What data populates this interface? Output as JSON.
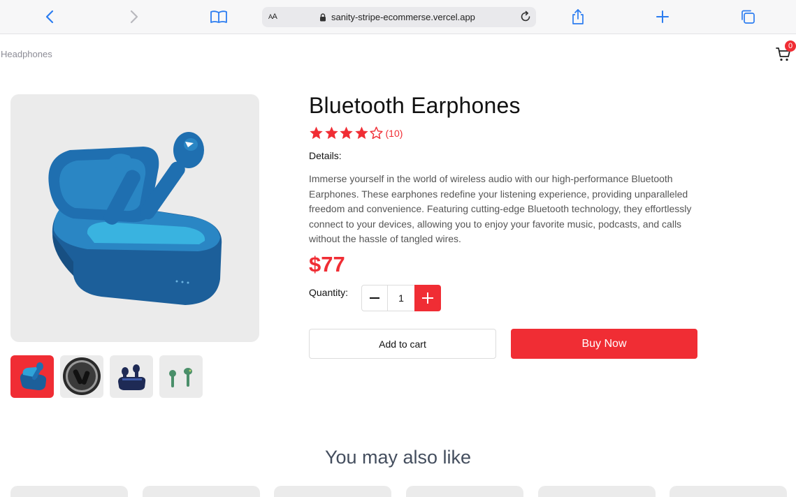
{
  "browser": {
    "aa_label": "AA",
    "url": "sanity-stripe-ecommerse.vercel.app"
  },
  "nav": {
    "breadcrumb": "Headphones",
    "cart_count": "0"
  },
  "product": {
    "title": "Bluetooth Earphones",
    "rating_stars": 4,
    "rating_max": 5,
    "review_count": "(10)",
    "details_label": "Details:",
    "description": "Immerse yourself in the world of wireless audio with our high-performance Bluetooth Earphones. These earphones redefine your listening experience, providing unparalleled freedom and convenience. Featuring cutting-edge Bluetooth technology, they effortlessly connect to your devices, allowing you to enjoy your favorite music, podcasts, and calls without the hassle of tangled wires.",
    "price": "$77",
    "quantity_label": "Quantity:",
    "quantity": "1",
    "add_to_cart_label": "Add to cart",
    "buy_now_label": "Buy Now"
  },
  "recommendations": {
    "title": "You may also like"
  },
  "colors": {
    "accent": "#f02d34",
    "earbud_blue": "#1f6fb0",
    "earbud_light": "#2fa3d8"
  }
}
